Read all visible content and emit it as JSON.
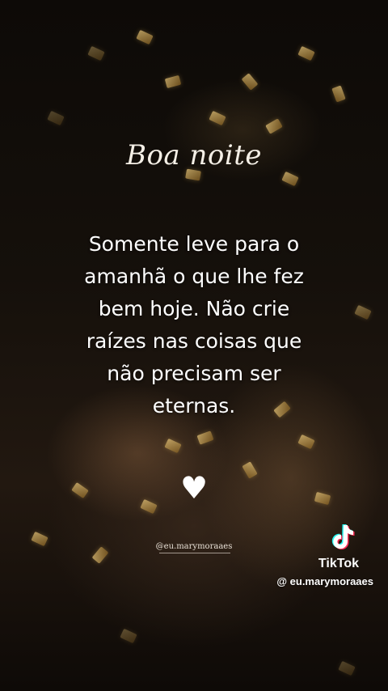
{
  "title": "Boa noite",
  "quote_lines": [
    "Somente leve para o",
    "amanhã o que lhe fez",
    "bem hoje. Não crie",
    "raízes nas coisas que",
    "não precisam ser",
    "eternas."
  ],
  "heart_symbol": "♥",
  "handle_small": "@eu.marymoraaes",
  "watermark": {
    "icon": "tiktok-logo-icon",
    "brand": "TikTok",
    "user": "@ eu.marymoraaes"
  },
  "colors": {
    "text": "#ffffff",
    "confetti_gold": "#d8b26a",
    "background": "#0b0806"
  }
}
